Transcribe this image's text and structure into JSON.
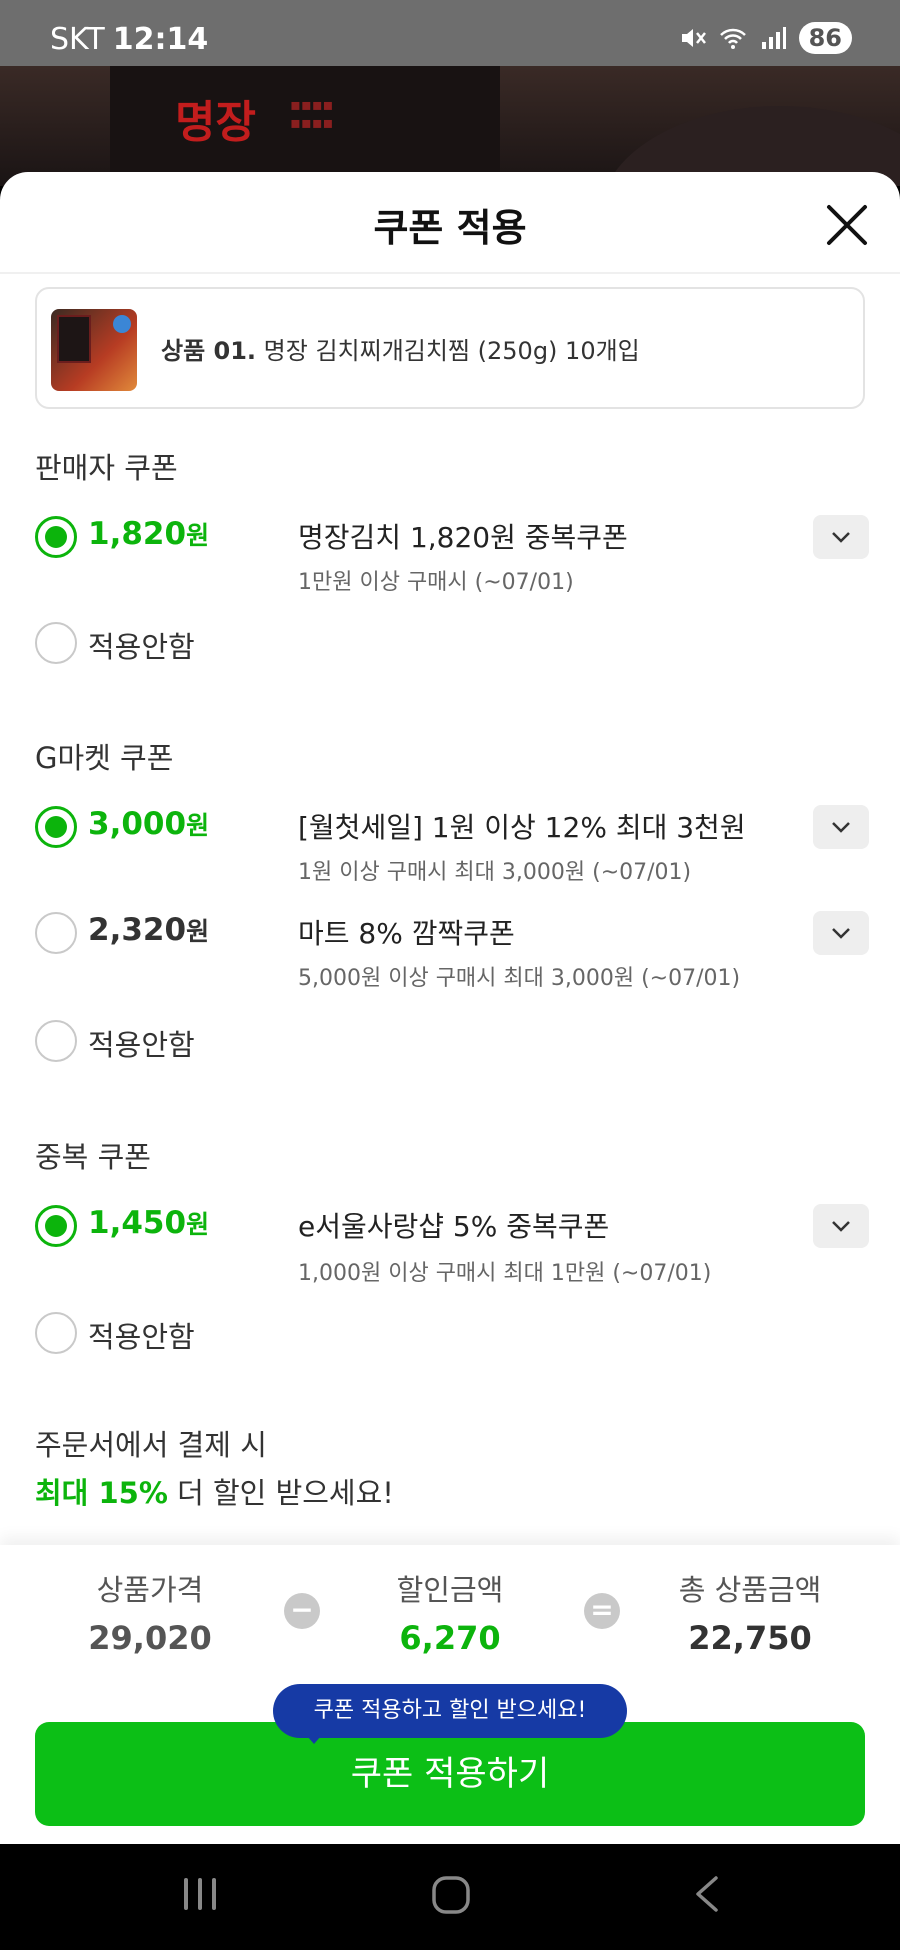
{
  "status_bar": {
    "carrier": "SKT",
    "time": "12:14",
    "battery": "86",
    "icons": [
      "mute-icon",
      "wifi-icon",
      "signal-icon",
      "battery-icon"
    ]
  },
  "background": {
    "brand_text": "명장"
  },
  "sheet": {
    "title": "쿠폰 적용"
  },
  "product": {
    "number": "상품 01.",
    "name": "명장 김치찌개김치찜 (250g) 10개입"
  },
  "seller_section": {
    "title": "판매자 쿠폰",
    "coupons": [
      {
        "amount": "1,820",
        "unit": "원",
        "name": "명장김치 1,820원 중복쿠폰",
        "desc": "1만원 이상 구매시 (~07/01)",
        "selected": true
      }
    ],
    "none_label": "적용안함"
  },
  "gmarket_section": {
    "title": "G마켓 쿠폰",
    "coupons": [
      {
        "amount": "3,000",
        "unit": "원",
        "name": "[월첫세일] 1원 이상 12% 최대 3천원",
        "desc": "1원 이상 구매시 최대 3,000원 (~07/01)",
        "selected": true
      },
      {
        "amount": "2,320",
        "unit": "원",
        "name": "마트 8% 깜짝쿠폰",
        "desc": "5,000원 이상 구매시 최대 3,000원 (~07/01)",
        "selected": false
      }
    ],
    "none_label": "적용안함"
  },
  "dup_section": {
    "title": "중복 쿠폰",
    "coupons": [
      {
        "amount": "1,450",
        "unit": "원",
        "name": "e서울사랑샵 5% 중복쿠폰",
        "desc": "1,000원 이상 구매시 최대 1만원 (~07/01)",
        "selected": true
      }
    ],
    "none_label": "적용안함"
  },
  "promo": {
    "line1": "주문서에서 결제 시",
    "highlight": "최대 15%",
    "line2_rest": " 더 할인 받으세요!"
  },
  "summary": {
    "price_label": "상품가격",
    "price_value": "29,020",
    "minus": "−",
    "discount_label": "할인금액",
    "discount_value": "6,270",
    "equals": "=",
    "total_label": "총 상품금액",
    "total_value": "22,750"
  },
  "tooltip": "쿠폰 적용하고 할인 받으세요!",
  "apply_button": "쿠폰 적용하기",
  "colors": {
    "accent_green": "#0cb40c",
    "button_green": "#0cbf16",
    "tooltip_blue": "#163aa5"
  }
}
